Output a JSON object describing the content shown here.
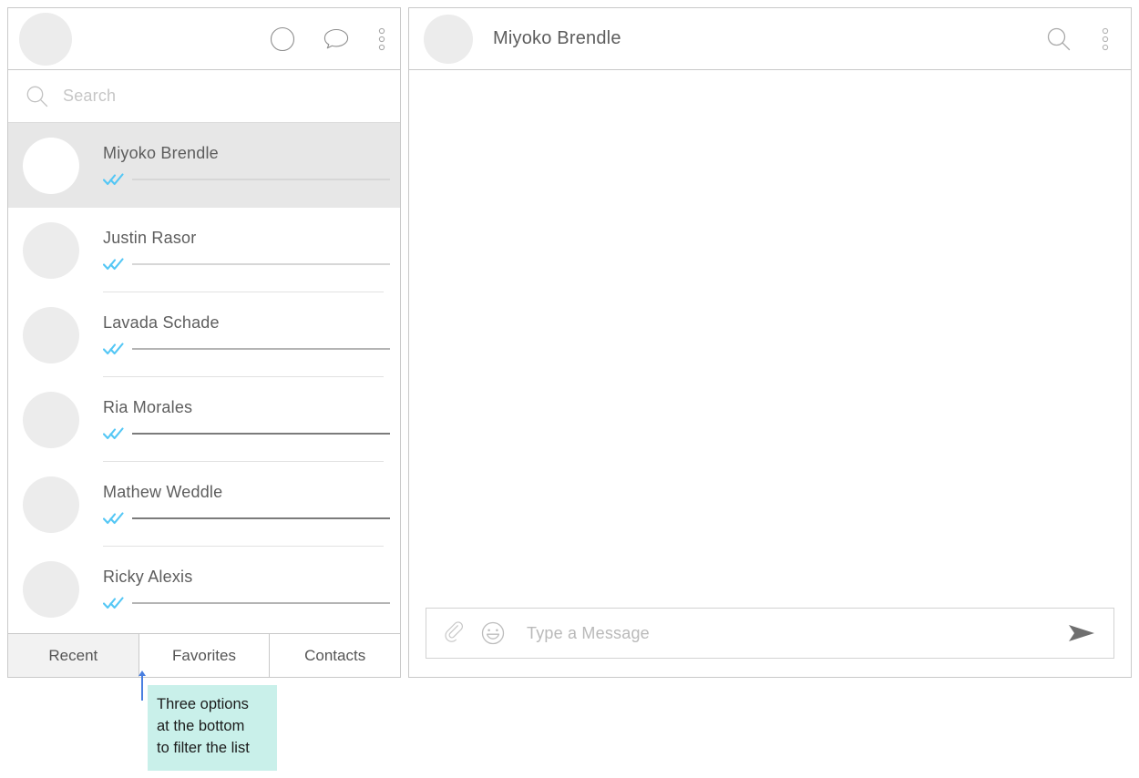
{
  "colors": {
    "accent_check": "#54c7f5",
    "panel_border": "#c9c9c9",
    "selected_row_bg": "#e7e7e7",
    "annotation_bg": "#c9f0ea",
    "annotation_arrow": "#4a7fe0",
    "text_primary": "#5d5d5d",
    "placeholder": "#c6c6c6"
  },
  "left_panel": {
    "header": {
      "avatar": "user-avatar",
      "actions": [
        {
          "name": "status-circle-icon",
          "label": "Status"
        },
        {
          "name": "chat-bubble-icon",
          "label": "New chat"
        },
        {
          "name": "overflow-menu-icon",
          "label": "More options"
        }
      ]
    },
    "search": {
      "icon": "search-icon",
      "placeholder": "Search",
      "value": ""
    },
    "conversations": [
      {
        "name": "Miyoko Brendle",
        "read_status": "read",
        "preview_tone": "light",
        "preview_width": 283,
        "selected": true
      },
      {
        "name": "Justin Rasor",
        "read_status": "read",
        "preview_tone": "light",
        "preview_width": 283,
        "selected": false
      },
      {
        "name": "Lavada Schade",
        "read_status": "read",
        "preview_tone": "medium",
        "preview_width": 283,
        "selected": false
      },
      {
        "name": "Ria Morales",
        "read_status": "read",
        "preview_tone": "dark",
        "preview_width": 283,
        "selected": false
      },
      {
        "name": "Mathew Weddle",
        "read_status": "read",
        "preview_tone": "dark",
        "preview_width": 283,
        "selected": false
      },
      {
        "name": "Ricky Alexis",
        "read_status": "read",
        "preview_tone": "medium",
        "preview_width": 283,
        "selected": false
      }
    ],
    "tabs": [
      {
        "label": "Recent",
        "active": true
      },
      {
        "label": "Favorites",
        "active": false
      },
      {
        "label": "Contacts",
        "active": false
      }
    ]
  },
  "right_panel": {
    "header": {
      "avatar": "contact-avatar",
      "title": "Miyoko Brendle",
      "actions": [
        {
          "name": "search-icon",
          "label": "Search in conversation"
        },
        {
          "name": "overflow-menu-icon",
          "label": "More options"
        }
      ]
    },
    "composer": {
      "attach_icon": "paperclip-icon",
      "emoji_icon": "smiley-icon",
      "placeholder": "Type a Message",
      "value": "",
      "send_icon": "send-icon"
    }
  },
  "annotation": {
    "lines": [
      "Three options",
      "at the bottom",
      "to filter the list"
    ]
  }
}
